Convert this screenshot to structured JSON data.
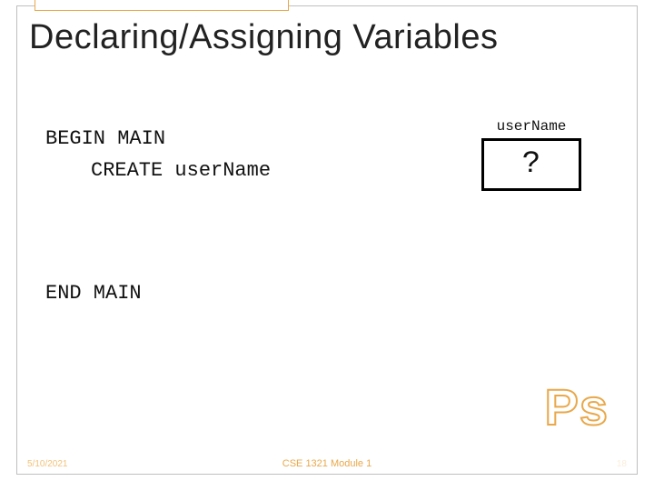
{
  "title": "Declaring/Assigning Variables",
  "code": {
    "line1": "BEGIN MAIN",
    "line2": "CREATE userName",
    "end": "END MAIN"
  },
  "variable": {
    "label": "userName",
    "value": "?"
  },
  "badge": "Ps",
  "footer": {
    "date": "5/10/2021",
    "center": "CSE 1321 Module 1",
    "page": "18"
  }
}
